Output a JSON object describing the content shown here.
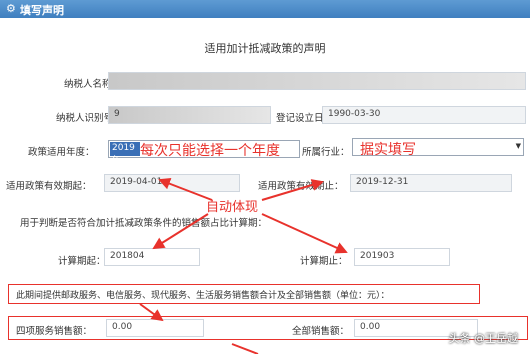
{
  "header": {
    "title": "填写声明"
  },
  "form": {
    "title": "适用加计抵减政策的声明",
    "taxpayer_name_label": "纳税人名称：",
    "taxpayer_id_label": "纳税人识别号：",
    "taxpayer_id_value": "9",
    "reg_date_label": "登记设立日期：",
    "reg_date_value": "1990-03-30",
    "policy_year_label": "政策适用年度：",
    "policy_year_value": "2019年",
    "industry_label": "所属行业：",
    "effective_start_label": "适用政策有效期起：",
    "effective_start_value": "2019-04-01",
    "effective_end_label": "适用政策有效期止：",
    "effective_end_value": "2019-12-31",
    "judge_text": "用于判断是否符合加计抵减政策条件的销售额占比计算期：",
    "calc_start_label": "计算期起：",
    "calc_start_value": "201804",
    "calc_end_label": "计算期止：",
    "calc_end_value": "201903",
    "period_text": "此期间提供邮政服务、电信服务、现代服务、生活服务销售额合计及全部销售额（单位：元）：",
    "four_services_label": "四项服务销售额：",
    "four_services_value": "0.00",
    "total_sales_label": "全部销售额：",
    "total_sales_value": "0.00"
  },
  "annotations": {
    "select_once": "每次只能选择一个年度",
    "fill_truthfully": "据实填写",
    "auto_show": "自动体现"
  },
  "watermark": "头条 @王岳越",
  "colors": {
    "header_blue": "#4a8bc8",
    "annotation_red": "#e8322c",
    "selected_blue": "#3a6fb6"
  }
}
